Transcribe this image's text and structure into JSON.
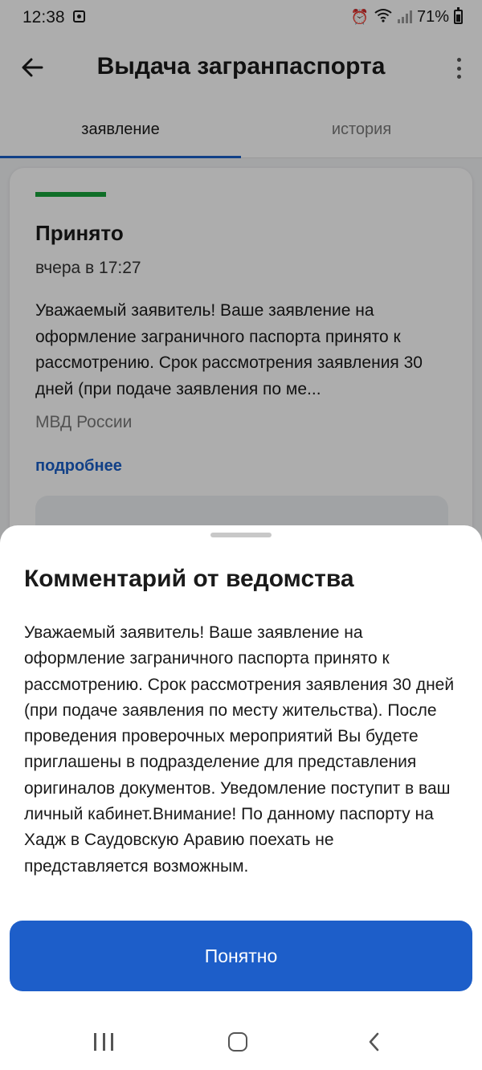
{
  "status_bar": {
    "time": "12:38",
    "battery": "71%"
  },
  "header": {
    "title": "Выдача загранпаспорта"
  },
  "tabs": [
    {
      "label": "заявление",
      "active": true
    },
    {
      "label": "история",
      "active": false
    }
  ],
  "card": {
    "status": "Принято",
    "date": "вчера в 17:27",
    "message": "Уважаемый заявитель! Ваше заявление на оформление заграничного паспорта принято к рассмотрению. Срок рассмотрения заявления 30 дней (при подаче заявления по ме...",
    "organization": "МВД России",
    "more_link": "подробнее"
  },
  "sheet": {
    "title": "Комментарий от ведомства",
    "text": "Уважаемый заявитель! Ваше заявление на оформление заграничного паспорта принято к рассмотрению. Срок рассмотрения заявления 30 дней (при подаче заявления по месту жительства). После проведения проверочных мероприятий Вы будете приглашены в подразделение для представления оригиналов документов. Уведомление поступит в ваш личный кабинет.Внимание! По данному паспорту на Хадж в Саудовскую Аравию поехать не представляется возможным.",
    "ok_button": "Понятно"
  },
  "colors": {
    "accent": "#1d5ec9",
    "status_accepted": "#17a33a",
    "link": "#1a5fc8"
  },
  "icons": {
    "back": "arrow-left-icon",
    "more": "more-vertical-icon",
    "alarm": "alarm-icon",
    "wifi": "wifi-icon",
    "signal": "signal-icon",
    "battery": "battery-icon"
  }
}
